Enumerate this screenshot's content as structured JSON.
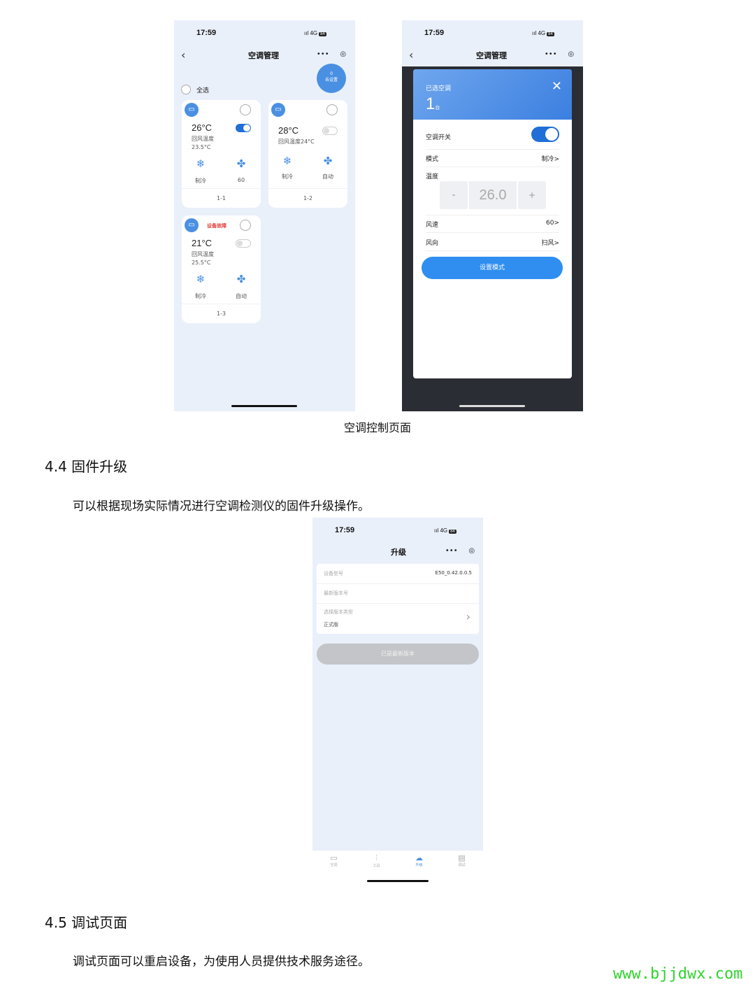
{
  "phone1": {
    "time": "17:59",
    "signal": "4G",
    "battery": "84",
    "title": "空调管理",
    "capsule_more": "•••",
    "capsule_close": "◎",
    "fab_count": "0",
    "fab_label": "去设置",
    "select_all": "全选",
    "cards": [
      {
        "temp": "26°C",
        "return_label": "回风温度",
        "return_value": "23.5°C",
        "mode": "制冷",
        "fan": "60",
        "number": "1-1",
        "power": "on"
      },
      {
        "temp": "28°C",
        "return_label": "回风温度24°C",
        "return_value": "",
        "mode": "制冷",
        "fan": "自动",
        "number": "1-2",
        "power": "off"
      },
      {
        "temp": "21°C",
        "return_label": "回风温度",
        "return_value": "25.5°C",
        "mode": "制冷",
        "fan": "自动",
        "number": "1-3",
        "power": "off",
        "fault": "设备故障"
      }
    ]
  },
  "phone2": {
    "time": "17:59",
    "signal": "4G",
    "battery": "84",
    "title": "空调管理",
    "capsule_more": "•••",
    "capsule_close": "◎",
    "selected_label": "已选空调",
    "selected_count": "1",
    "selected_unit": "台",
    "close": "✕",
    "power_label": "空调开关",
    "mode_label": "模式",
    "mode_value": "制冷>",
    "temp_label": "温度",
    "minus": "-",
    "temp_value": "26.0",
    "plus": "+",
    "fan_label": "风速",
    "fan_value": "60>",
    "swing_label": "风向",
    "swing_value": "扫风>",
    "set_button": "设置模式"
  },
  "caption": "空调控制页面",
  "section44": {
    "heading": "4.4  固件升级",
    "text": "可以根据现场实际情况进行空调检测仪的固件升级操作。"
  },
  "phone3": {
    "time": "17:59",
    "signal": "4G",
    "battery": "84",
    "title": "升级",
    "capsule_more": "•••",
    "capsule_close": "◎",
    "model_label": "设备型号",
    "model_value": "E50_0.42.0.0.5",
    "latest_label": "最新版本号",
    "type_label": "选择版本类型",
    "type_value": "正式版",
    "button": "已是最新版本",
    "tabs": [
      "空调",
      "工具",
      "升级",
      "调试"
    ]
  },
  "section45": {
    "heading": "4.5 调试页面",
    "text": "调试页面可以重启设备，为使用人员提供技术服务途径。"
  },
  "watermark": "www.bjjdwx.com"
}
